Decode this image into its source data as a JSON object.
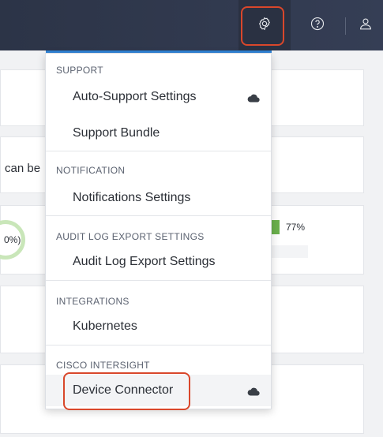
{
  "topbar": {
    "icons": [
      "gear-icon",
      "help-icon",
      "user-icon"
    ]
  },
  "background": {
    "partial_text": "can be",
    "ring_value": "0%)",
    "bar_percent": "77%"
  },
  "menu": {
    "sections": [
      {
        "header": "SUPPORT",
        "items": [
          {
            "label": "Auto-Support Settings",
            "icon": "cloud-icon"
          },
          {
            "label": "Support Bundle"
          }
        ]
      },
      {
        "header": "NOTIFICATION",
        "items": [
          {
            "label": "Notifications Settings"
          }
        ]
      },
      {
        "header": "AUDIT LOG EXPORT SETTINGS",
        "items": [
          {
            "label": "Audit Log Export Settings"
          }
        ]
      },
      {
        "header": "INTEGRATIONS",
        "items": [
          {
            "label": "Kubernetes"
          }
        ]
      },
      {
        "header": "CISCO INTERSIGHT",
        "items": [
          {
            "label": "Device Connector",
            "icon": "cloud-icon",
            "highlighted": true
          }
        ]
      }
    ]
  },
  "colors": {
    "topbar": "#2c3447",
    "accent_blue": "#2f83d6",
    "highlight_red": "#d9472b",
    "progress_green": "#6ab04c"
  }
}
